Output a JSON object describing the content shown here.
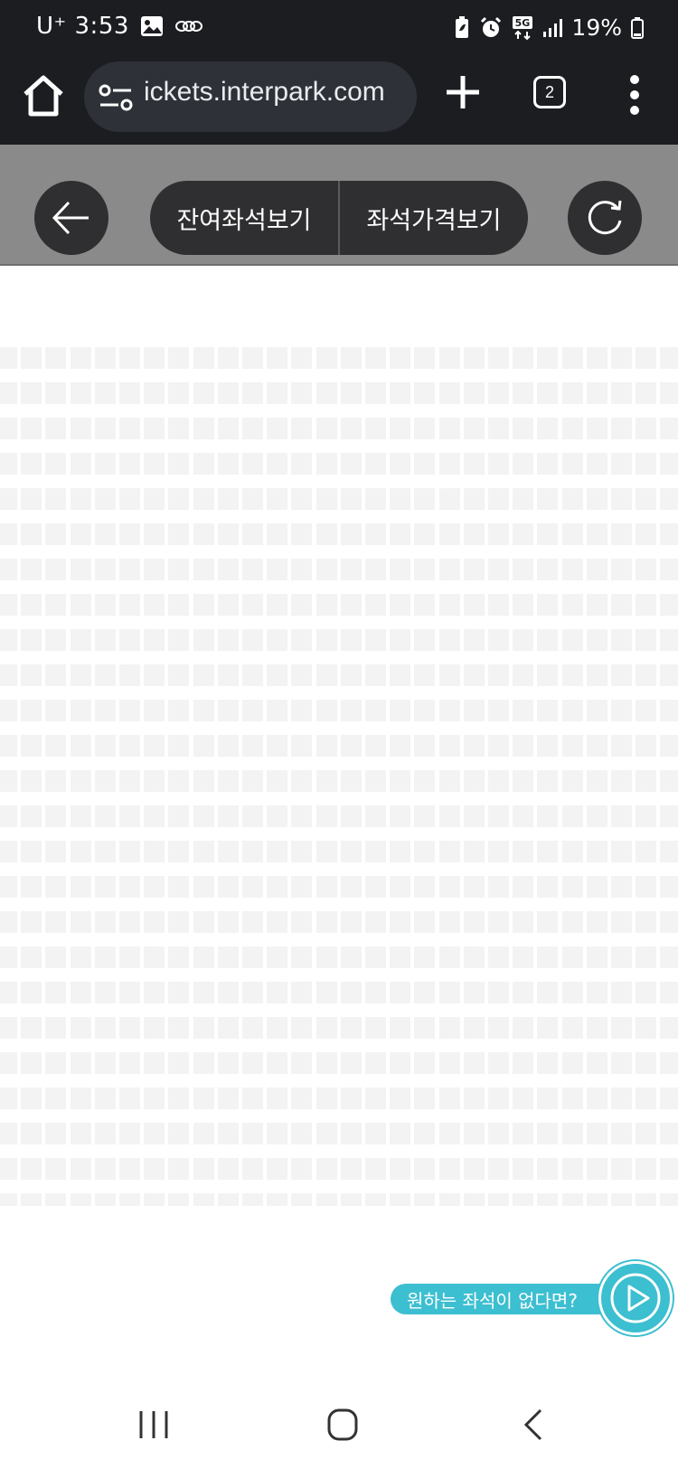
{
  "status_bar": {
    "carrier_time": "U⁺ 3:53",
    "battery": "19%",
    "icons": [
      "gallery-icon",
      "notification-icon",
      "battery-saver-icon",
      "alarm-icon",
      "5g-icon",
      "signal-icon",
      "battery-icon"
    ]
  },
  "browser": {
    "url": "ickets.interpark.com",
    "tab_count": "2",
    "icons": [
      "home-icon",
      "site-settings-icon",
      "new-tab-plus-icon",
      "tabs-icon",
      "more-menu-icon"
    ]
  },
  "toolbar": {
    "remaining_seats_label": "잔여좌석보기",
    "seat_price_label": "좌석가격보기",
    "icons": [
      "back-arrow-icon",
      "refresh-icon"
    ]
  },
  "seat_grid": {
    "rows": 25,
    "columns": 28,
    "seat_color": "#f3f3f3"
  },
  "help": {
    "label": "원하는 좌석이 없다면?",
    "accent_color": "#3cbfd0",
    "icon": "play-icon"
  },
  "nav_bar": {
    "icons": [
      "recents-icon",
      "home-circle-icon",
      "back-chevron-icon"
    ]
  }
}
